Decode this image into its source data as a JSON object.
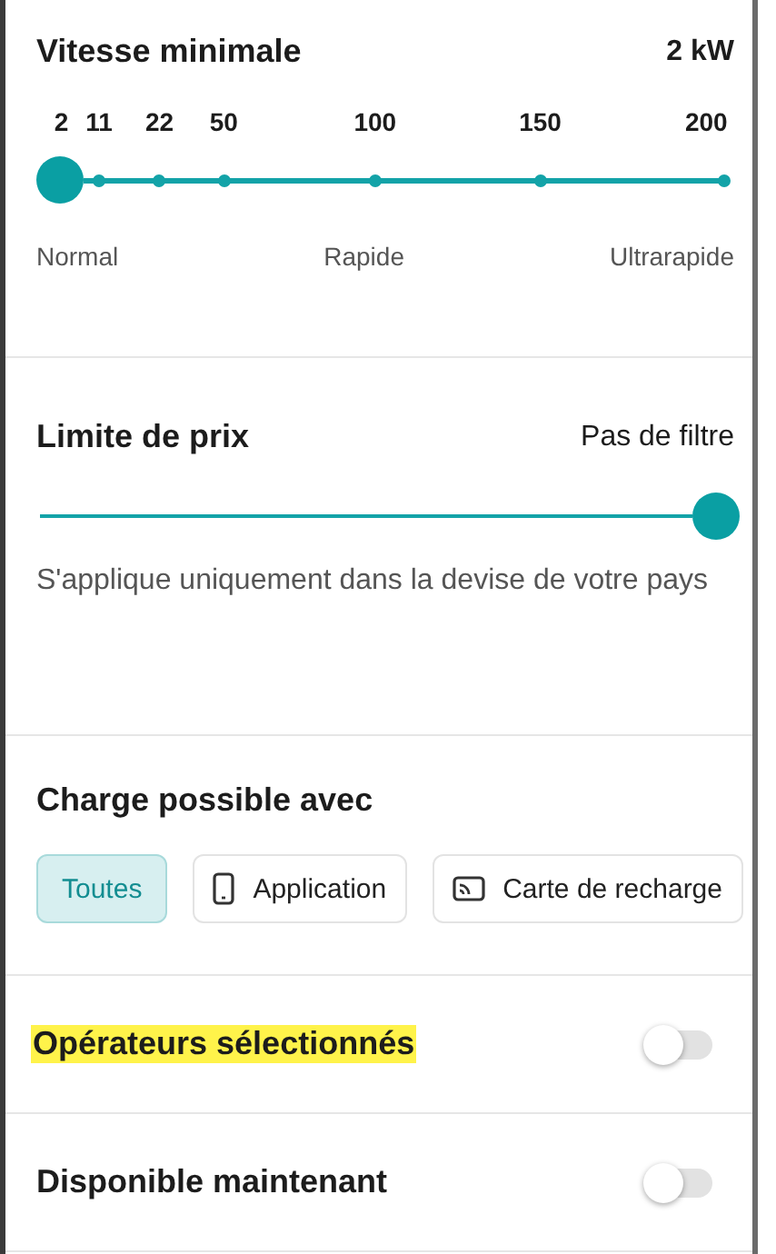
{
  "speed": {
    "title": "Vitesse minimale",
    "value": "2 kW",
    "ticks": [
      "2",
      "11",
      "22",
      "50",
      "100",
      "150",
      "200"
    ],
    "level": 0,
    "labels": [
      "Normal",
      "Rapide",
      "Ultrarapide"
    ]
  },
  "price": {
    "title": "Limite de prix",
    "value": "Pas de filtre",
    "level": 1,
    "note": "S'applique uniquement dans la devise de votre pays"
  },
  "charge": {
    "title": "Charge possible avec",
    "options": [
      {
        "label": "Toutes",
        "kind": "text",
        "selected": true
      },
      {
        "label": "Application",
        "kind": "phone",
        "selected": false
      },
      {
        "label": "Carte de recharge",
        "kind": "card",
        "selected": false
      }
    ]
  },
  "toggles": [
    {
      "label": "Opérateurs sélectionnés",
      "on": false,
      "highlighted": true
    },
    {
      "label": "Disponible maintenant",
      "on": false,
      "highlighted": false
    }
  ]
}
